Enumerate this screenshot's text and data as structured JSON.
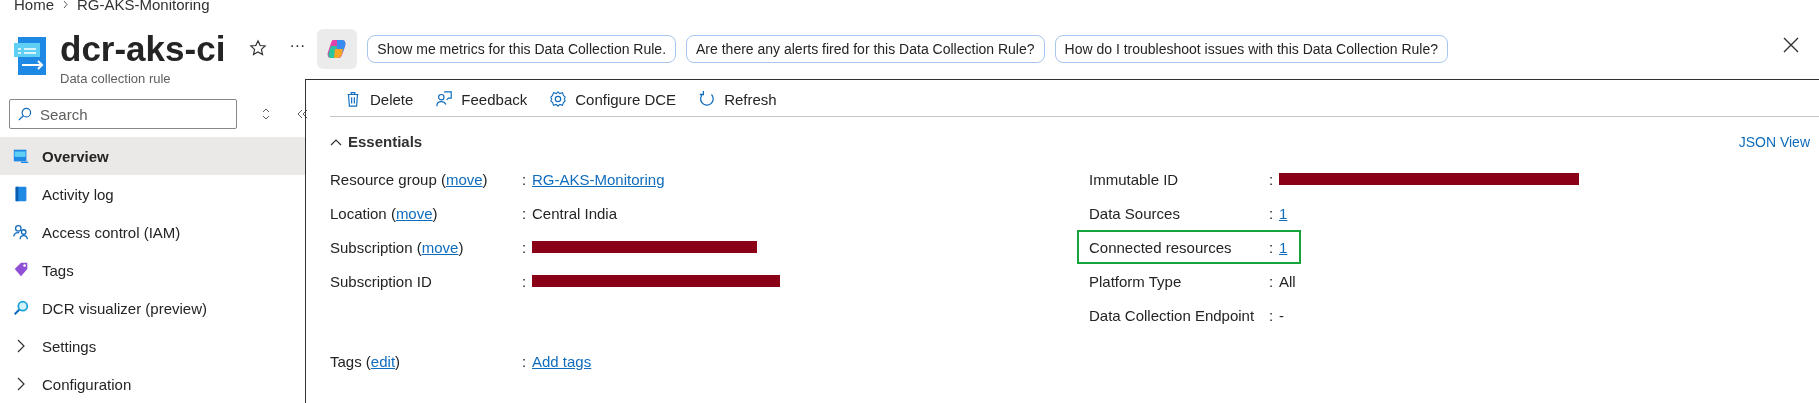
{
  "breadcrumb": [
    {
      "label": "Home"
    },
    {
      "label": "RG-AKS-Monitoring"
    }
  ],
  "header": {
    "title": "dcr-aks-ci",
    "subtitle": "Data collection rule",
    "ellipsis": "···",
    "favorite": false,
    "suggestions": [
      "Show me metrics for this Data Collection Rule.",
      "Are there any alerts fired for this Data Collection Rule?",
      "How do I troubleshoot issues with this Data Collection Rule?"
    ]
  },
  "sidebar": {
    "search": {
      "placeholder": "Search"
    },
    "items": [
      {
        "label": "Overview",
        "kind": "item",
        "selected": true
      },
      {
        "label": "Activity log",
        "kind": "item",
        "selected": false
      },
      {
        "label": "Access control (IAM)",
        "kind": "item",
        "selected": false
      },
      {
        "label": "Tags",
        "kind": "item",
        "selected": false
      },
      {
        "label": "DCR visualizer (preview)",
        "kind": "item",
        "selected": false
      },
      {
        "label": "Settings",
        "kind": "group",
        "selected": false,
        "expanded": false
      },
      {
        "label": "Configuration",
        "kind": "group",
        "selected": false,
        "expanded": false
      }
    ]
  },
  "toolbar": [
    {
      "label": "Delete"
    },
    {
      "label": "Feedback"
    },
    {
      "label": "Configure DCE"
    },
    {
      "label": "Refresh"
    }
  ],
  "essentials": {
    "title": "Essentials",
    "expanded": true,
    "json_view": "JSON View",
    "left": [
      {
        "label": "Resource group (",
        "link": "move",
        "suffix": ")",
        "sep": ":",
        "value": "RG-AKS-Monitoring",
        "kind": "link"
      },
      {
        "label": "Location (",
        "link": "move",
        "suffix": ")",
        "sep": ":",
        "value": "Central India",
        "kind": "text"
      },
      {
        "label": "Subscription (",
        "link": "move",
        "suffix": ")",
        "sep": ":",
        "kind": "redacted"
      },
      {
        "label": "Subscription ID",
        "sep": ":",
        "kind": "redacted"
      }
    ],
    "tags": {
      "label": "Tags (",
      "link": "edit",
      "suffix": ")",
      "sep": ":",
      "value": "Add tags",
      "kind": "link"
    },
    "right": [
      {
        "label": "Immutable ID",
        "sep": ":",
        "kind": "redacted",
        "highlighted": false
      },
      {
        "label": "Data Sources",
        "sep": ":",
        "value": "1",
        "kind": "underlined",
        "highlighted": false
      },
      {
        "label": "Connected resources",
        "sep": ":",
        "value": "1",
        "kind": "underlined",
        "highlighted": true
      },
      {
        "label": "Platform Type",
        "sep": ":",
        "value": "All",
        "kind": "text",
        "highlighted": false
      },
      {
        "label": "Data Collection Endpoint",
        "sep": ":",
        "value": "-",
        "kind": "text",
        "highlighted": false
      }
    ]
  }
}
